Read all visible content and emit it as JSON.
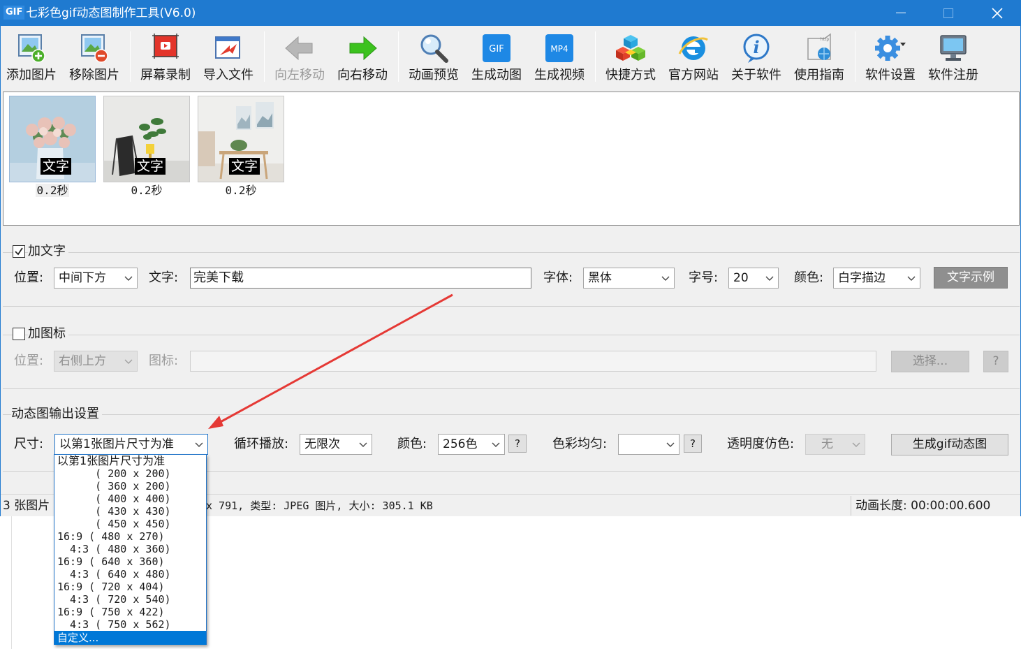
{
  "window": {
    "app_icon_text": "GIF",
    "title": "七彩色gif动态图制作工具(V6.0)"
  },
  "toolbar": {
    "items": [
      {
        "label": "添加图片",
        "icon": "add-image-icon"
      },
      {
        "label": "移除图片",
        "icon": "remove-image-icon"
      },
      {
        "label": "屏幕录制",
        "icon": "screen-record-icon"
      },
      {
        "label": "导入文件",
        "icon": "import-file-icon"
      },
      {
        "label": "向左移动",
        "icon": "arrow-left-icon",
        "disabled": true
      },
      {
        "label": "向右移动",
        "icon": "arrow-right-icon"
      },
      {
        "label": "动画预览",
        "icon": "magnifier-icon"
      },
      {
        "label": "生成动图",
        "icon": "gif-icon",
        "badge": "GIF"
      },
      {
        "label": "生成视频",
        "icon": "mp4-icon",
        "badge": "MP4"
      },
      {
        "label": "快捷方式",
        "icon": "shortcut-cubes-icon"
      },
      {
        "label": "官方网站",
        "icon": "browser-icon"
      },
      {
        "label": "关于软件",
        "icon": "info-icon"
      },
      {
        "label": "使用指南",
        "icon": "guide-icon"
      },
      {
        "label": "软件设置",
        "icon": "gear-icon"
      },
      {
        "label": "软件注册",
        "icon": "monitor-icon"
      }
    ]
  },
  "images": [
    {
      "caption": "文字",
      "duration": "0.2秒"
    },
    {
      "caption": "文字",
      "duration": "0.2秒"
    },
    {
      "caption": "文字",
      "duration": "0.2秒"
    }
  ],
  "text_group": {
    "checkbox_label": "加文字",
    "checked": true,
    "position_label": "位置:",
    "position_value": "中间下方",
    "text_label": "文字:",
    "text_value": "完美下载",
    "font_label": "字体:",
    "font_value": "黑体",
    "size_label": "字号:",
    "size_value": "20",
    "color_label": "颜色:",
    "color_value": "白字描边",
    "sample_button": "文字示例"
  },
  "icon_group": {
    "checkbox_label": "加图标",
    "checked": false,
    "position_label": "位置:",
    "position_value": "右侧上方",
    "icon_label": "图标:",
    "icon_value": "",
    "choose_button": "选择...",
    "help_button": "?"
  },
  "output_group": {
    "title": "动态图输出设置",
    "size_label": "尺寸:",
    "size_value": "以第1张图片尺寸为准",
    "loop_label": "循环播放:",
    "loop_value": "无限次",
    "color_label": "颜色:",
    "color_value": "256色",
    "color_help": "?",
    "balance_label": "色彩均匀:",
    "balance_value": "",
    "balance_help": "?",
    "transparency_label": "透明度仿色:",
    "transparency_value": "无",
    "generate_button": "生成gif动态图"
  },
  "size_options": [
    "以第1张图片尺寸为准",
    "      ( 200 x 200)",
    "      ( 360 x 200)",
    "      ( 400 x 400)",
    "      ( 430 x 430)",
    "      ( 450 x 450)",
    "16:9 ( 480 x 270)",
    "  4:3 ( 480 x 360)",
    "16:9 ( 640 x 360)",
    "  4:3 ( 640 x 480)",
    "16:9 ( 720 x 404)",
    "  4:3 ( 720 x 540)",
    "16:9 ( 750 x 422)",
    "  4:3 ( 750 x 562)",
    "自定义..."
  ],
  "selected_option_index": 14,
  "statusbar": {
    "count": "3 张图片",
    "info": "x 791, 类型: JPEG 图片, 大小: 305.1 KB",
    "duration": "动画长度: 00:00:00.600"
  },
  "colors": {
    "titlebar": "#1f7ad0",
    "selection": "#0078d7",
    "arrow": "#e53935"
  }
}
